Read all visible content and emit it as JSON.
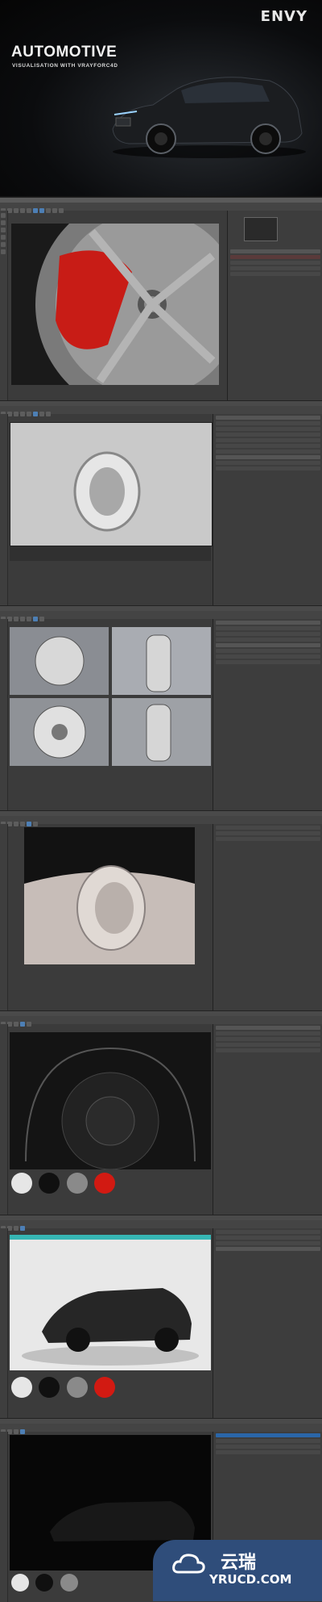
{
  "hero": {
    "brand": "ENVY",
    "title": "AUTOMOTIVE",
    "subtitle": "VISUALISATION WITH VRAYFORC4D"
  },
  "picture_viewer": {
    "window_title": "Picture Viewer"
  },
  "menus": [
    "File",
    "Edit",
    "Create",
    "Select",
    "Tools",
    "Mesh",
    "Snap",
    "Animate",
    "Simulate",
    "Render",
    "Sculpt",
    "MoGraph",
    "Character",
    "Pipeline",
    "Plugins",
    "Script",
    "Window",
    "Help"
  ],
  "viewport_menus": [
    "View",
    "Cameras",
    "Display",
    "Options",
    "Filter",
    "Panel"
  ],
  "materials": [
    {
      "name": "white",
      "color": "#e6e6e6"
    },
    {
      "name": "black",
      "color": "#101010"
    },
    {
      "name": "chrome",
      "color": "#8a8a8a"
    },
    {
      "name": "red",
      "color": "#d21a12"
    }
  ],
  "watermark": {
    "chinese": "云瑞",
    "domain": "YRUCD.COM"
  }
}
